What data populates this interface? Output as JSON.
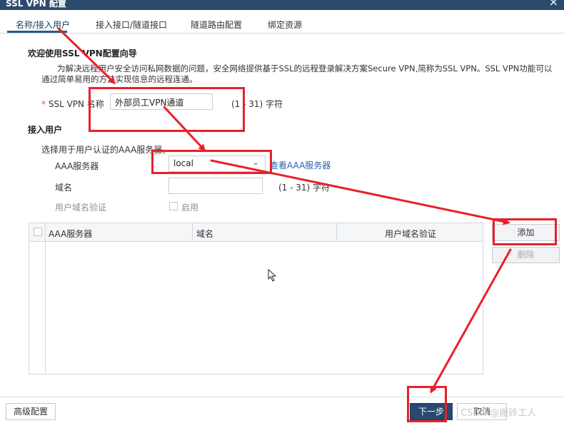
{
  "dialog": {
    "title": "SSL VPN 配置",
    "close_glyph": "×"
  },
  "tabs": [
    {
      "label": "名称/接入用户",
      "active": true
    },
    {
      "label": "接入接口/隧道接口"
    },
    {
      "label": "隧道路由配置"
    },
    {
      "label": "绑定资源"
    }
  ],
  "intro": {
    "heading": "欢迎使用SSL VPN配置向导",
    "line1": "为解决远程用户安全访问私网数据的问题，安全网络提供基于SSL的远程登录解决方案Secure VPN,简称为SSL VPN。SSL VPN功能可以",
    "line2": "通过简单易用的方法实现信息的远程连通。"
  },
  "name_field": {
    "required_mark": "*",
    "label": "SSL VPN 名称",
    "value": "外部员工VPN通道",
    "hint": "(1 - 31) 字符"
  },
  "access": {
    "heading": "接入用户",
    "desc": "选择用于用户认证的AAA服务器。",
    "aaa_label": "AAA服务器",
    "aaa_value": "local",
    "aaa_link": "查看AAA服务器",
    "domain_label": "域名",
    "domain_value": "",
    "domain_hint": "(1 - 31) 字符",
    "verify_label": "用户域名验证",
    "verify_option": "启用"
  },
  "table": {
    "columns": [
      "AAA服务器",
      "域名",
      "用户域名验证"
    ],
    "rows": []
  },
  "buttons": {
    "add": "添加",
    "delete": "删除",
    "advanced": "高级配置",
    "next": "下一步",
    "cancel": "取消"
  },
  "colors": {
    "highlight": "#e8202a",
    "primary": "#284970",
    "link": "#2b64b0",
    "titlebar": "#2b4a6b"
  },
  "watermark": "CSDN @搬砖工人"
}
